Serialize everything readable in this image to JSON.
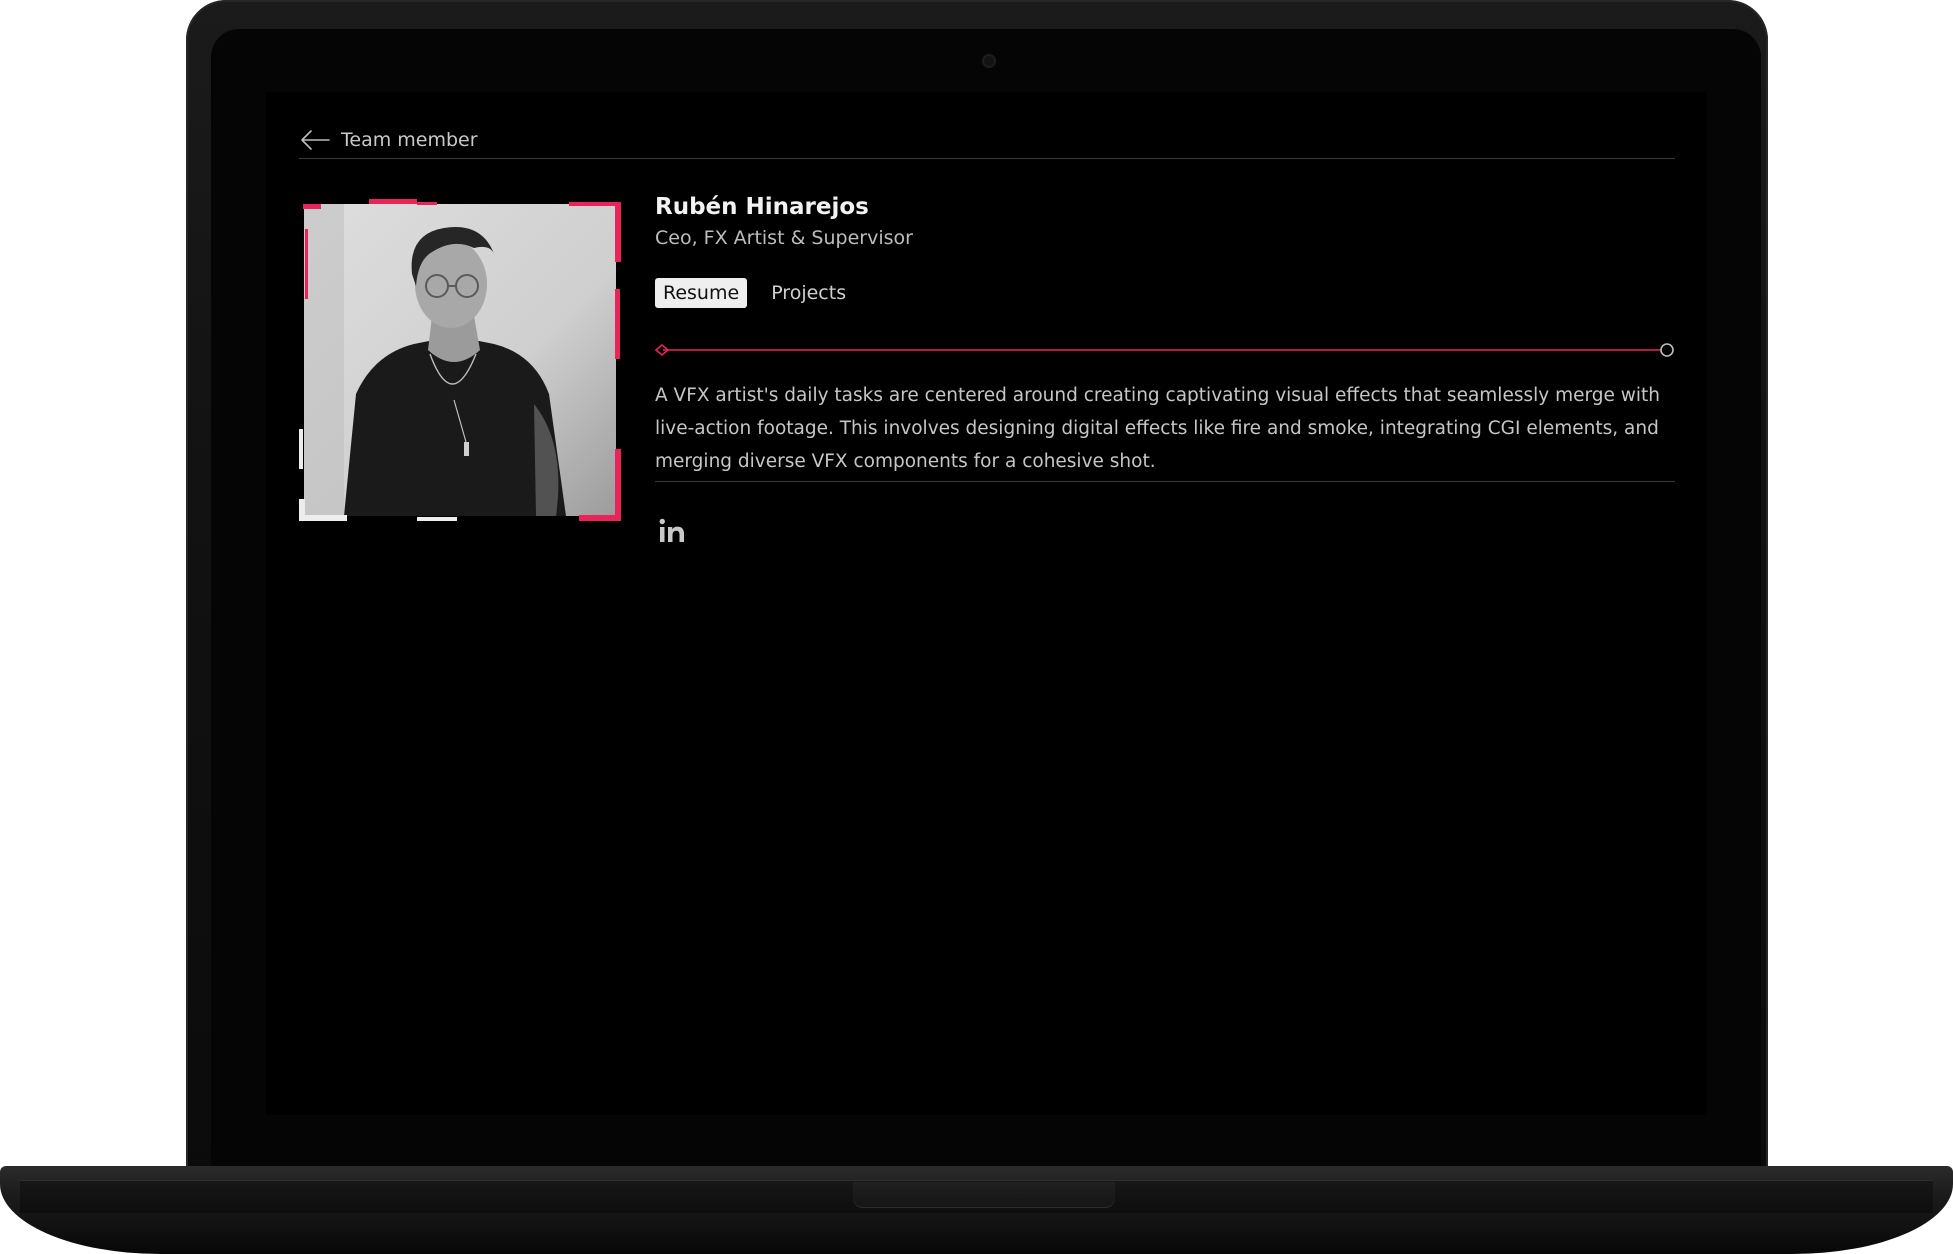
{
  "header": {
    "back_label": "Team member"
  },
  "profile": {
    "name": "Rubén Hinarejos",
    "role": "Ceo, FX Artist & Supervisor",
    "photo_alt": "Portrait of Rubén Hinarejos"
  },
  "tabs": [
    {
      "label": "Resume",
      "active": true
    },
    {
      "label": "Projects",
      "active": false
    }
  ],
  "bio": "A VFX artist's daily tasks are centered around creating captivating visual effects that seamlessly merge with live-action footage. This involves designing digital effects like fire and smoke, integrating CGI elements, and merging diverse VFX components for a cohesive shot.",
  "social": {
    "linkedin_label": "in"
  },
  "colors": {
    "accent": "#e8245a",
    "background": "#000000",
    "text_primary": "#f2f2f2",
    "text_secondary": "#c6c6c6"
  },
  "icons": {
    "back": "arrow-left-icon",
    "social": "linkedin-icon"
  }
}
